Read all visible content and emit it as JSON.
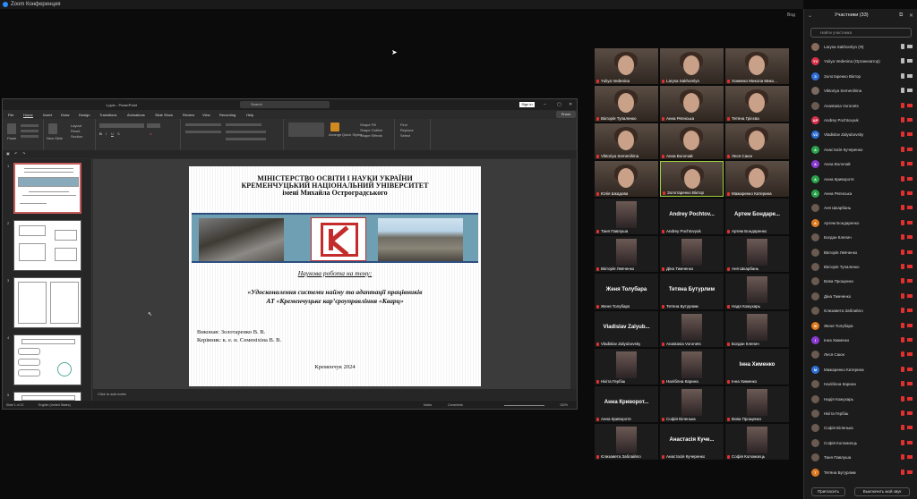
{
  "app": {
    "title": "Zoom Конференция",
    "view_label": "Вод"
  },
  "ppt": {
    "doc_title": "1.pptx - PowerPoint",
    "search_placeholder": "Search",
    "sign_in": "Sign in",
    "menu": [
      "File",
      "Home",
      "Insert",
      "Draw",
      "Design",
      "Transitions",
      "Animations",
      "Slide Show",
      "Review",
      "View",
      "Recording",
      "Help"
    ],
    "share": "Share",
    "ribbon_groups": [
      "Clipboard",
      "Slides",
      "Font",
      "Paragraph",
      "Drawing",
      "Editing"
    ],
    "ribbon_texts": {
      "paste": "Paste",
      "new_slide": "New Slide",
      "layout": "Layout",
      "reset": "Reset",
      "section": "Section",
      "arrange": "Arrange",
      "quick_styles": "Quick Styles",
      "find": "Find",
      "replace": "Replace",
      "select": "Select",
      "shape_fill": "Shape Fill",
      "shape_outline": "Shape Outline",
      "shape_effects": "Shape Effects"
    },
    "notes_placeholder": "Click to add notes",
    "status": {
      "slide": "Slide 1 of 12",
      "lang": "English (United States)",
      "notes": "Notes",
      "comments": "Comments",
      "zoom": "102%"
    }
  },
  "slide": {
    "header": [
      "МІНІСТЕРСТВО ОСВІТИ І НАУКИ УКРАЇНИ",
      "КРЕМЕНЧУЦЬКИЙ НАЦІОНАЛЬНИЙ УНІВЕРСИТЕТ",
      "імені Михайла Остроградського"
    ],
    "subtitle1": "Наукова робота на тему:",
    "subtitle2": [
      "«Удосконалення системи найму та адаптації працівників",
      "АТ «Кременчуцьке кар’єроуправління «Кварц»"
    ],
    "author": "Виконав: Золотаренко В. В.",
    "supervisor": "Керівник: к. е. н. Семеніхіна В. В.",
    "city": "Кременчук 2024"
  },
  "gallery": [
    {
      "name": "Yuliya Vedenina",
      "type": "cam"
    },
    {
      "name": "Larysa Sakhomlyn",
      "type": "cam"
    },
    {
      "name": "Хоменко Микола Мико...",
      "type": "cam"
    },
    {
      "name": "Вікторія Тупаленко",
      "type": "cam"
    },
    {
      "name": "Анна Репнська",
      "type": "cam"
    },
    {
      "name": "Тетяна Грієєва",
      "type": "cam"
    },
    {
      "name": "Viktoriya Semenihina",
      "type": "cam"
    },
    {
      "name": "Анна Волочай",
      "type": "cam"
    },
    {
      "name": "Леся Саюн",
      "type": "cam"
    },
    {
      "name": "Юлія Шкадова",
      "type": "cam"
    },
    {
      "name": "Золотаренко Віктор",
      "type": "cam",
      "hl": true
    },
    {
      "name": "Мажаренко Катерина",
      "type": "cam"
    },
    {
      "name": "Таня Павлуша",
      "type": "av"
    },
    {
      "name": "Andrey Pochtovyuk",
      "type": "big",
      "big": "Andrey Pochtov..."
    },
    {
      "name": "Артем Бондаренко",
      "type": "big",
      "big": "Артем Бондаре..."
    },
    {
      "name": "Вікторія Левченко",
      "type": "av"
    },
    {
      "name": "Діна Тимченко",
      "type": "av"
    },
    {
      "name": "Аня Шкарбань",
      "type": "av"
    },
    {
      "name": "Женя Толубара",
      "type": "big",
      "big": "Женя Толубара"
    },
    {
      "name": "Тетяна Бутурлим",
      "type": "big",
      "big": "Тетяна Бутурлим"
    },
    {
      "name": "Надя Кожухарь",
      "type": "av"
    },
    {
      "name": "Vladislav Zalyubovsky",
      "type": "big",
      "big": "Vladislav Zalyub..."
    },
    {
      "name": "Anastasia Voronets",
      "type": "av"
    },
    {
      "name": "Богдан Клепач",
      "type": "av"
    },
    {
      "name": "Нікіта Гербіш",
      "type": "av"
    },
    {
      "name": "Наліблна Карина",
      "type": "av"
    },
    {
      "name": "Інна Хименко",
      "type": "big",
      "big": "Інна Химeнко"
    },
    {
      "name": "Анна Криворотя",
      "type": "big",
      "big": "Анна Криворот..."
    },
    {
      "name": "Софія Біленька",
      "type": "av"
    },
    {
      "name": "Вова Прощенко",
      "type": "av"
    },
    {
      "name": "Єлизавета Заблаійло",
      "type": "av"
    },
    {
      "name": "Анастасія Кучеренко",
      "type": "big",
      "big": "Анастасія Куче..."
    },
    {
      "name": "Софія Коломоєць",
      "type": "av"
    }
  ],
  "participants": {
    "title": "Участники (33)",
    "search_placeholder": "Найти участника",
    "list": [
      {
        "name": "Larysa Sakhomlyn (Я)",
        "init": "",
        "color": "#8a6a5a",
        "mic": "on",
        "cam": "on"
      },
      {
        "name": "Yuliya Vedenina (Организатор)",
        "init": "YV",
        "color": "#d9314a",
        "mic": "on",
        "cam": "on"
      },
      {
        "name": "Золотаренко Віктор",
        "init": "З",
        "color": "#2f6fd6",
        "mic": "on",
        "cam": "on"
      },
      {
        "name": "Viktoriya Semenihina",
        "init": "",
        "color": "#7a6a60",
        "mic": "on",
        "cam": "on"
      },
      {
        "name": "Anastasia Voronets",
        "init": "",
        "color": "#6a5a50",
        "mic": "off",
        "cam": "off"
      },
      {
        "name": "Andrey Pochtovyuk",
        "init": "AP",
        "color": "#d9314a",
        "mic": "off",
        "cam": "off"
      },
      {
        "name": "Vladislav Zalyubovsky",
        "init": "VZ",
        "color": "#2f6fd6",
        "mic": "off",
        "cam": "off"
      },
      {
        "name": "Анастасія Кучеренко",
        "init": "А",
        "color": "#2aa44a",
        "mic": "off",
        "cam": "off"
      },
      {
        "name": "Анна Волочай",
        "init": "А",
        "color": "#8a3ad0",
        "mic": "off",
        "cam": "off"
      },
      {
        "name": "Анна Криворотя",
        "init": "А",
        "color": "#2aa44a",
        "mic": "off",
        "cam": "off"
      },
      {
        "name": "Анна Репнська",
        "init": "А",
        "color": "#2aa44a",
        "mic": "off",
        "cam": "off"
      },
      {
        "name": "Аня Шкарбань",
        "init": "",
        "color": "#6a5a50",
        "mic": "off",
        "cam": "off"
      },
      {
        "name": "Артем Бондаренко",
        "init": "А",
        "color": "#e07a20",
        "mic": "off",
        "cam": "off"
      },
      {
        "name": "Богдан Клепач",
        "init": "",
        "color": "#6a5a50",
        "mic": "off",
        "cam": "off"
      },
      {
        "name": "Вікторія Левченко",
        "init": "",
        "color": "#6a5a50",
        "mic": "off",
        "cam": "off"
      },
      {
        "name": "Вікторія Тупаленко",
        "init": "",
        "color": "#6a5a50",
        "mic": "off",
        "cam": "off"
      },
      {
        "name": "Вова Прощенко",
        "init": "",
        "color": "#6a5a50",
        "mic": "off",
        "cam": "off"
      },
      {
        "name": "Діна Тимченко",
        "init": "",
        "color": "#6a5a50",
        "mic": "off",
        "cam": "off"
      },
      {
        "name": "Єлизавета Заблайло",
        "init": "",
        "color": "#6a5a50",
        "mic": "off",
        "cam": "off"
      },
      {
        "name": "Женя Толубара",
        "init": "Ж",
        "color": "#e07a20",
        "mic": "off",
        "cam": "off"
      },
      {
        "name": "Інна Хименко",
        "init": "І",
        "color": "#8a3ad0",
        "mic": "off",
        "cam": "off"
      },
      {
        "name": "Леся Саюн",
        "init": "",
        "color": "#6a5a50",
        "mic": "off",
        "cam": "off"
      },
      {
        "name": "Мажаренко Катерина",
        "init": "М",
        "color": "#2f6fd6",
        "mic": "off",
        "cam": "off"
      },
      {
        "name": "Наліблна Карина",
        "init": "",
        "color": "#6a5a50",
        "mic": "off",
        "cam": "off"
      },
      {
        "name": "Надія Кожухарь",
        "init": "",
        "color": "#6a5a50",
        "mic": "off",
        "cam": "off"
      },
      {
        "name": "Нікіта Гербіш",
        "init": "",
        "color": "#6a5a50",
        "mic": "off",
        "cam": "off"
      },
      {
        "name": "Софія Біленька",
        "init": "",
        "color": "#6a5a50",
        "mic": "off",
        "cam": "off"
      },
      {
        "name": "Софія Коломоєць",
        "init": "",
        "color": "#6a5a50",
        "mic": "off",
        "cam": "off"
      },
      {
        "name": "Таня Павлуша",
        "init": "",
        "color": "#6a5a50",
        "mic": "off",
        "cam": "off"
      },
      {
        "name": "Тетяна Бутурлим",
        "init": "Т",
        "color": "#e07a20",
        "mic": "off",
        "cam": "off"
      }
    ],
    "invite": "Пригласить",
    "mute_all": "Выключить мой звук"
  }
}
